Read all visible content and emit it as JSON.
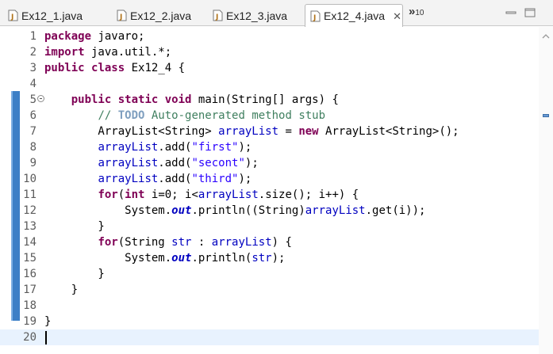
{
  "tabs": [
    {
      "label": "Ex12_1.java",
      "active": false
    },
    {
      "label": "Ex12_2.java",
      "active": false
    },
    {
      "label": "Ex12_3.java",
      "active": false
    },
    {
      "label": "Ex12_4.java",
      "active": true
    }
  ],
  "tab_close": "✕",
  "overflow": {
    "chevron": "»",
    "count": "10"
  },
  "colors": {
    "keyword": "#7f0055",
    "string": "#2a00ff",
    "field": "#0000c0",
    "comment": "#3f7f5f",
    "todo": "#7f9fbf",
    "ruler": "#3d7fc6",
    "current_line": "#e8f2fe"
  },
  "editor": {
    "line_numbers": [
      "1",
      "2",
      "3",
      "4",
      "5",
      "6",
      "7",
      "8",
      "9",
      "10",
      "11",
      "12",
      "13",
      "14",
      "15",
      "16",
      "17",
      "18",
      "19",
      "20"
    ],
    "fold_marker_line": "5",
    "lines": [
      [
        {
          "t": "kw",
          "v": "package"
        },
        {
          "t": "p",
          "v": " javaro;"
        }
      ],
      [
        {
          "t": "kw",
          "v": "import"
        },
        {
          "t": "p",
          "v": " java.util.*;"
        }
      ],
      [
        {
          "t": "kw",
          "v": "public"
        },
        {
          "t": "p",
          "v": " "
        },
        {
          "t": "kw",
          "v": "class"
        },
        {
          "t": "p",
          "v": " Ex12_4 {"
        }
      ],
      [],
      [
        {
          "t": "p",
          "v": "    "
        },
        {
          "t": "kw",
          "v": "public"
        },
        {
          "t": "p",
          "v": " "
        },
        {
          "t": "kw",
          "v": "static"
        },
        {
          "t": "p",
          "v": " "
        },
        {
          "t": "kw",
          "v": "void"
        },
        {
          "t": "p",
          "v": " main(String[] args) {"
        }
      ],
      [
        {
          "t": "p",
          "v": "        "
        },
        {
          "t": "cmt",
          "v": "// "
        },
        {
          "t": "todo",
          "v": "TODO"
        },
        {
          "t": "cmt",
          "v": " Auto-generated method stub"
        }
      ],
      [
        {
          "t": "p",
          "v": "        ArrayList<String> "
        },
        {
          "t": "fld",
          "v": "arrayList"
        },
        {
          "t": "p",
          "v": " = "
        },
        {
          "t": "kw",
          "v": "new"
        },
        {
          "t": "p",
          "v": " ArrayList<String>();"
        }
      ],
      [
        {
          "t": "p",
          "v": "        "
        },
        {
          "t": "fld",
          "v": "arrayList"
        },
        {
          "t": "p",
          "v": ".add("
        },
        {
          "t": "str",
          "v": "\"first\""
        },
        {
          "t": "p",
          "v": ");"
        }
      ],
      [
        {
          "t": "p",
          "v": "        "
        },
        {
          "t": "fld",
          "v": "arrayList"
        },
        {
          "t": "p",
          "v": ".add("
        },
        {
          "t": "str",
          "v": "\"secont\""
        },
        {
          "t": "p",
          "v": ");"
        }
      ],
      [
        {
          "t": "p",
          "v": "        "
        },
        {
          "t": "fld",
          "v": "arrayList"
        },
        {
          "t": "p",
          "v": ".add("
        },
        {
          "t": "str",
          "v": "\"third\""
        },
        {
          "t": "p",
          "v": ");"
        }
      ],
      [
        {
          "t": "p",
          "v": "        "
        },
        {
          "t": "kw",
          "v": "for"
        },
        {
          "t": "p",
          "v": "("
        },
        {
          "t": "kw",
          "v": "int"
        },
        {
          "t": "p",
          "v": " i=0; i<"
        },
        {
          "t": "fld",
          "v": "arrayList"
        },
        {
          "t": "p",
          "v": ".size(); i++) {"
        }
      ],
      [
        {
          "t": "p",
          "v": "            System."
        },
        {
          "t": "sfld",
          "v": "out"
        },
        {
          "t": "p",
          "v": ".println((String)"
        },
        {
          "t": "fld",
          "v": "arrayList"
        },
        {
          "t": "p",
          "v": ".get(i));"
        }
      ],
      [
        {
          "t": "p",
          "v": "        }"
        }
      ],
      [
        {
          "t": "p",
          "v": "        "
        },
        {
          "t": "kw",
          "v": "for"
        },
        {
          "t": "p",
          "v": "(String "
        },
        {
          "t": "fld",
          "v": "str"
        },
        {
          "t": "p",
          "v": " : "
        },
        {
          "t": "fld",
          "v": "arrayList"
        },
        {
          "t": "p",
          "v": ") {"
        }
      ],
      [
        {
          "t": "p",
          "v": "            System."
        },
        {
          "t": "sfld",
          "v": "out"
        },
        {
          "t": "p",
          "v": ".println("
        },
        {
          "t": "fld",
          "v": "str"
        },
        {
          "t": "p",
          "v": ");"
        }
      ],
      [
        {
          "t": "p",
          "v": "        }"
        }
      ],
      [
        {
          "t": "p",
          "v": "    }"
        }
      ],
      [],
      [
        {
          "t": "p",
          "v": "}"
        }
      ],
      []
    ],
    "current_line": "20"
  }
}
